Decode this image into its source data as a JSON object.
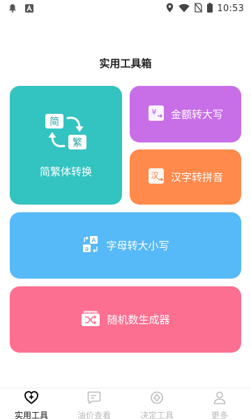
{
  "status_bar": {
    "time": "10:53",
    "icons": [
      "notification-bell-icon",
      "text-app-icon",
      "location-icon",
      "wifi-icon",
      "no-sim-icon",
      "battery-icon"
    ]
  },
  "page": {
    "title": "实用工具箱"
  },
  "tools": {
    "jianfan": {
      "label": "简繁体转换",
      "glyph_simplified": "简",
      "glyph_traditional": "繁",
      "color": "#33c3c1"
    },
    "jine": {
      "label": "金额转大写",
      "glyph": "¥",
      "color": "#c86fe8"
    },
    "hanzi": {
      "label": "汉字转拼音",
      "glyph": "汉",
      "color": "#ff8a4b"
    },
    "zimu": {
      "label": "字母转大小写",
      "glyph_upper": "A",
      "glyph_lower": "a",
      "color": "#56b9f8"
    },
    "suiji": {
      "label": "随机数生成器",
      "color": "#fd6f91"
    }
  },
  "bottom_nav": {
    "items": [
      {
        "label": "实用工具",
        "icon": "heart-plus-icon",
        "active": true
      },
      {
        "label": "油价查看",
        "icon": "chat-card-icon",
        "active": false
      },
      {
        "label": "决定工具",
        "icon": "target-icon",
        "active": false
      },
      {
        "label": "更多",
        "icon": "user-icon",
        "active": false
      }
    ]
  }
}
